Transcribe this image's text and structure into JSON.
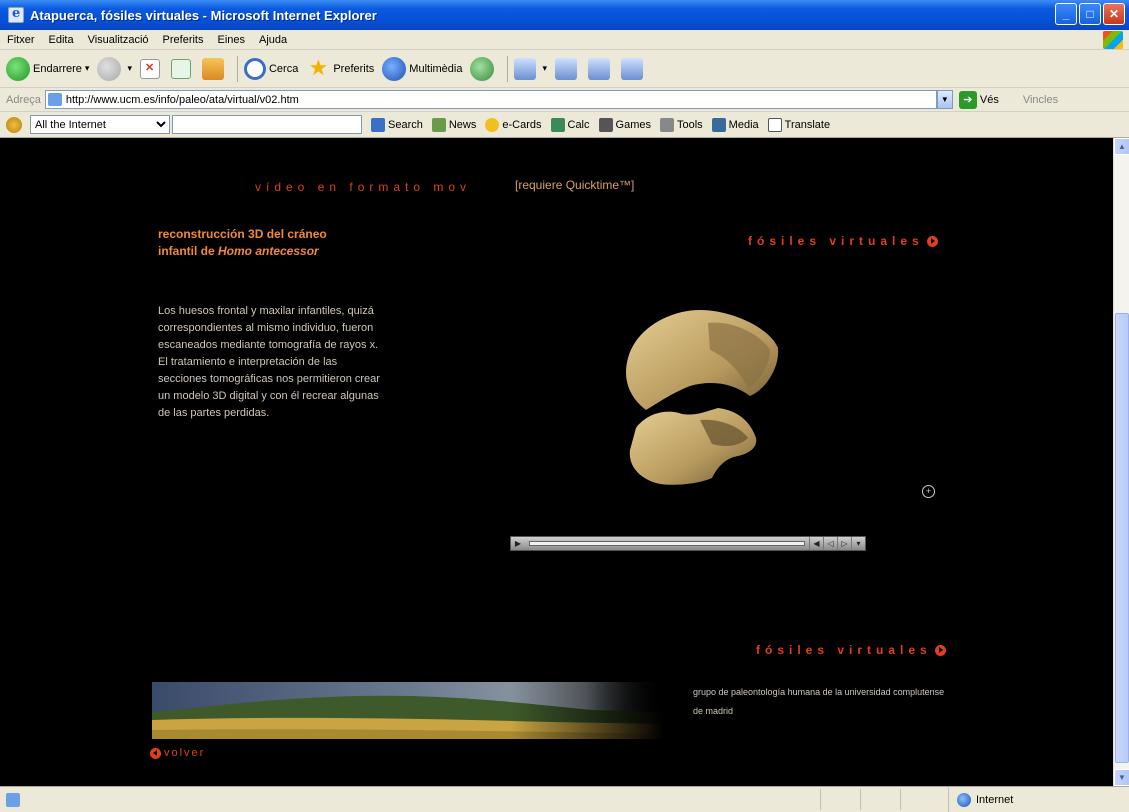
{
  "window": {
    "title": "Atapuerca, fósiles virtuales - Microsoft Internet Explorer",
    "buttons": {
      "minimize": "_",
      "maximize": "□",
      "close": "✕"
    }
  },
  "menu": [
    "Fitxer",
    "Edita",
    "Visualització",
    "Preferits",
    "Eines",
    "Ajuda"
  ],
  "toolbar": {
    "back_label": "Endarrere",
    "search_label": "Cerca",
    "favorites_label": "Preferits",
    "media_label": "Multimèdia"
  },
  "address": {
    "label": "Adreça",
    "url": "http://www.ucm.es/info/paleo/ata/virtual/v02.htm",
    "go_label": "Vés",
    "links_label": "Vincles"
  },
  "searchbar": {
    "scope": "All the Internet",
    "items": [
      "Search",
      "News",
      "e-Cards",
      "Calc",
      "Games",
      "Tools",
      "Media",
      "Translate"
    ]
  },
  "content": {
    "video_title": "vídeo en formato mov",
    "video_note": "[requiere Quicktime™]",
    "heading_part1": "reconstrucción 3D del cráneo infantil de ",
    "heading_species": "Homo antecessor",
    "description": "Los huesos frontal y maxilar infantiles, quizá correspondientes al mismo individuo, fueron escaneados mediante tomografía de rayos x. El tratamiento e interpretación de las secciones tomográficas nos permitieron crear un modelo 3D digital y con él recrear algunas de las partes perdidas.",
    "nav_link_top": "fósiles virtuales",
    "nav_link_bottom": "fósiles virtuales",
    "footer_text": "grupo de paleontología humana de la universidad complutense de madrid",
    "back_link": "volver"
  },
  "statusbar": {
    "zone": "Internet"
  },
  "colors": {
    "accent_red": "#e0401a",
    "heading_orange": "#f08a3a",
    "body_text": "#cfc7b8",
    "xp_blue": "#0a5ae0"
  }
}
